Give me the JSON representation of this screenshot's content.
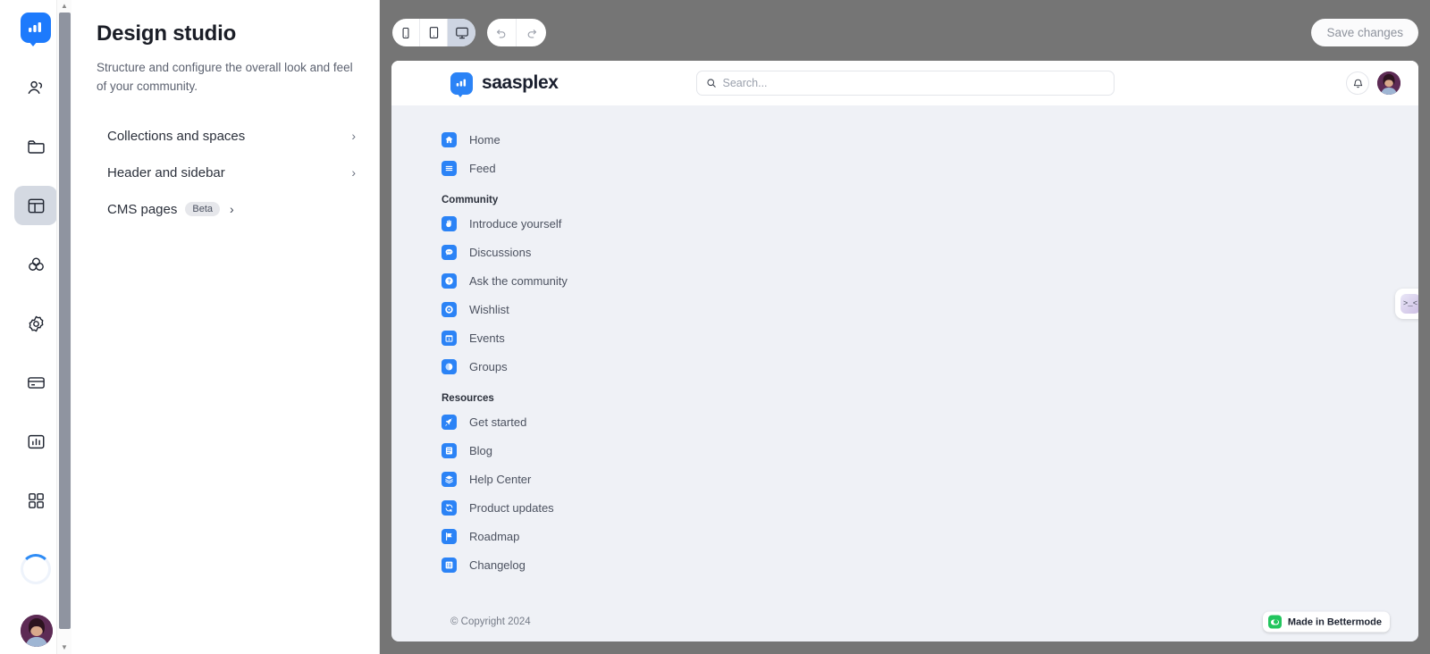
{
  "app": {
    "rail": {
      "logo_icon": "bettermode-logo-icon",
      "items": [
        {
          "icon": "people-icon",
          "name": "members",
          "active": false
        },
        {
          "icon": "folder-icon",
          "name": "content",
          "active": false
        },
        {
          "icon": "layout-icon",
          "name": "design",
          "active": true
        },
        {
          "icon": "apps-circles-icon",
          "name": "appearance",
          "active": false
        },
        {
          "icon": "gear-icon",
          "name": "settings",
          "active": false
        },
        {
          "icon": "card-icon",
          "name": "billing",
          "active": false
        },
        {
          "icon": "bar-chart-icon",
          "name": "analytics",
          "active": false
        },
        {
          "icon": "grid-icon",
          "name": "apps",
          "active": false
        }
      ],
      "loading_spinner": "loading-spinner",
      "account_avatar": "account-avatar"
    }
  },
  "panel": {
    "title": "Design studio",
    "subtitle": "Structure and configure the overall look and feel of your community.",
    "rows": [
      {
        "label": "Collections and spaces",
        "badge": null,
        "chevron": "›"
      },
      {
        "label": "Header and sidebar",
        "badge": null,
        "chevron": "›"
      },
      {
        "label": "CMS pages",
        "badge": "Beta",
        "chevron": "›"
      }
    ]
  },
  "toolbar": {
    "devices": [
      {
        "name": "mobile-view",
        "icon": "phone-icon",
        "active": false
      },
      {
        "name": "tablet-view",
        "icon": "tablet-icon",
        "active": false
      },
      {
        "name": "desktop-view",
        "icon": "desktop-icon",
        "active": true
      }
    ],
    "undo_label": "↶",
    "redo_label": "↷",
    "save_label": "Save changes",
    "save_disabled": true
  },
  "preview": {
    "header": {
      "brand_name": "saasplex",
      "brand_mark": "saasplex-logo-icon",
      "search_placeholder": "Search...",
      "search_value": "",
      "notifications_icon": "bell-icon",
      "avatar": "user-avatar"
    },
    "nav": [
      {
        "type": "item",
        "label": "Home",
        "icon": "home-icon"
      },
      {
        "type": "item",
        "label": "Feed",
        "icon": "feed-icon"
      },
      {
        "type": "section",
        "label": "Community"
      },
      {
        "type": "item",
        "label": "Introduce yourself",
        "icon": "wave-hand-icon"
      },
      {
        "type": "item",
        "label": "Discussions",
        "icon": "chat-bubble-icon"
      },
      {
        "type": "item",
        "label": "Ask the community",
        "icon": "question-icon"
      },
      {
        "type": "item",
        "label": "Wishlist",
        "icon": "target-icon"
      },
      {
        "type": "item",
        "label": "Events",
        "icon": "calendar-icon"
      },
      {
        "type": "item",
        "label": "Groups",
        "icon": "circle-half-icon"
      },
      {
        "type": "section",
        "label": "Resources"
      },
      {
        "type": "item",
        "label": "Get started",
        "icon": "rocket-icon"
      },
      {
        "type": "item",
        "label": "Blog",
        "icon": "article-icon"
      },
      {
        "type": "item",
        "label": "Help Center",
        "icon": "layers-icon"
      },
      {
        "type": "item",
        "label": "Product updates",
        "icon": "refresh-icon"
      },
      {
        "type": "item",
        "label": "Roadmap",
        "icon": "flag-icon"
      },
      {
        "type": "item",
        "label": "Changelog",
        "icon": "list-icon"
      }
    ],
    "footer": {
      "copyright": "© Copyright 2024",
      "badge_text": "Made in Bettermode",
      "badge_icon": "bettermode-green-icon"
    },
    "edge_fab": {
      "name": "collapse-panel-button",
      "glyph": ">_<"
    }
  },
  "colors": {
    "brand_blue": "#2b83f6",
    "rail_active_bg": "#d4d9e2",
    "canvas_bg": "#757575",
    "preview_bg": "#eff1f6",
    "badge_green": "#22c55e"
  }
}
